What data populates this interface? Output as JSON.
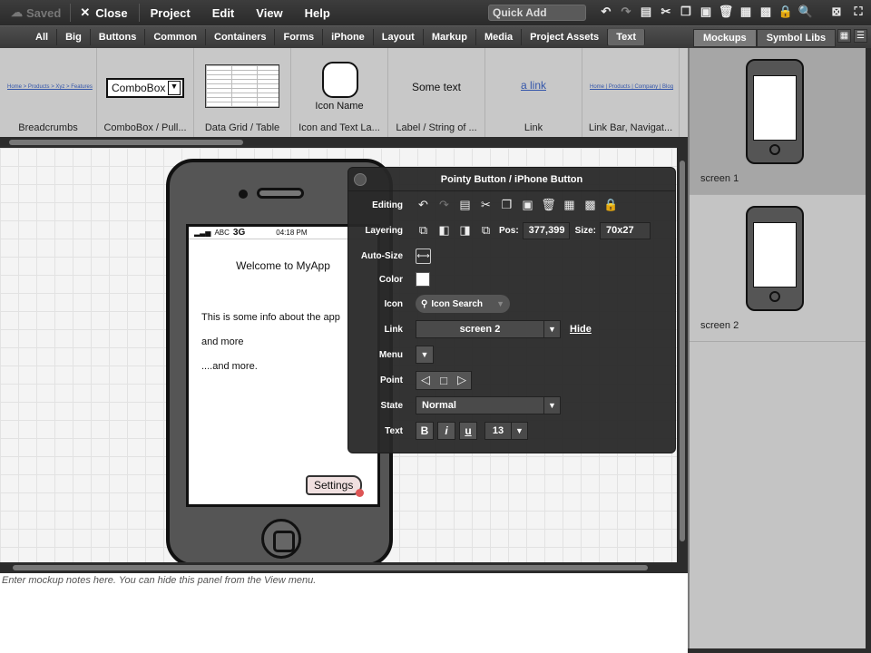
{
  "menubar": {
    "saved_label": "Saved",
    "close_label": "Close",
    "menus": [
      "Project",
      "Edit",
      "View",
      "Help"
    ],
    "quick_add": "Quick Add"
  },
  "categories": [
    "All",
    "Big",
    "Buttons",
    "Common",
    "Containers",
    "Forms",
    "iPhone",
    "Layout",
    "Markup",
    "Media",
    "Project Assets",
    "Text"
  ],
  "active_category": "Text",
  "right_tabs": [
    "Mockups",
    "Symbol Libs"
  ],
  "library": {
    "items": [
      {
        "label": "Breadcrumbs",
        "preview": "Home > Products > Xyz > Features"
      },
      {
        "label": "ComboBox / Pull...",
        "preview": "ComboBox"
      },
      {
        "label": "Data Grid / Table",
        "preview": ""
      },
      {
        "label": "Icon and Text La...",
        "preview": "Icon Name"
      },
      {
        "label": "Label / String of ...",
        "preview": "Some text"
      },
      {
        "label": "Link",
        "preview": "a link"
      },
      {
        "label": "Link Bar, Navigat...",
        "preview": "Home | Products | Company | Blog"
      }
    ]
  },
  "mockup": {
    "carrier": "ABC",
    "network": "3G",
    "time": "04:18 PM",
    "title": "Welcome to MyApp",
    "line1": "This is some info about the app",
    "line2": "and more",
    "line3": "....and more.",
    "button": "Settings"
  },
  "props": {
    "title": "Pointy Button / iPhone Button",
    "editing": "Editing",
    "layering": "Layering",
    "pos_label": "Pos:",
    "pos": "377,399",
    "size_label": "Size:",
    "size": "70x27",
    "autosize": "Auto-Size",
    "color": "Color",
    "icon": "Icon",
    "icon_search": "Icon Search",
    "link": "Link",
    "link_value": "screen 2",
    "hide": "Hide",
    "menu": "Menu",
    "point": "Point",
    "state": "State",
    "state_value": "Normal",
    "text": "Text",
    "font_size": "13"
  },
  "notes": "Enter mockup notes here. You can hide this panel from the View menu.",
  "screens": [
    "screen 1",
    "screen 2"
  ]
}
